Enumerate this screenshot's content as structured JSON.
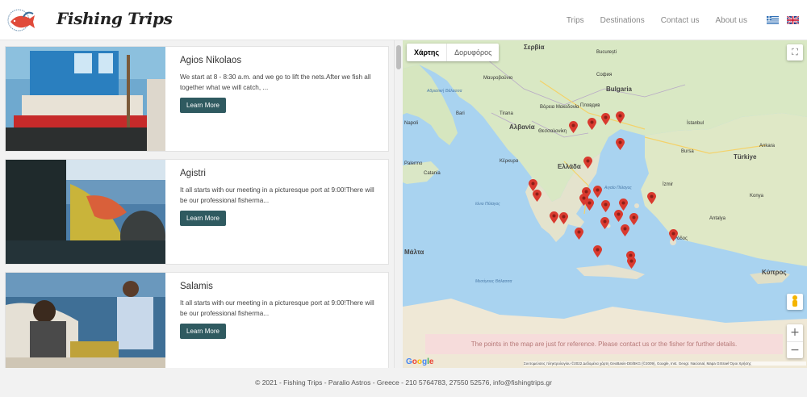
{
  "brand": {
    "name": "Fishing Trips"
  },
  "nav": {
    "items": [
      {
        "label": "Trips"
      },
      {
        "label": "Destinations"
      },
      {
        "label": "Contact us"
      },
      {
        "label": "About us"
      }
    ]
  },
  "trips": [
    {
      "title": "Agios Nikolaos",
      "description": "We start at 8 - 8:30 a.m. and we go to lift the nets.After we fish all together what we will catch, ...",
      "button": "Learn More"
    },
    {
      "title": "Agistri",
      "description": "It all starts with our meeting in a picturesque port at 9:00!There will be our professional fisherma...",
      "button": "Learn More"
    },
    {
      "title": "Salamis",
      "description": "It all starts with our meeting in a picturesque port at 9:00!There will be our professional fisherma...",
      "button": "Learn More"
    }
  ],
  "map": {
    "type_map": "Χάρτης",
    "type_satellite": "Δορυφόρος",
    "notice": "The points in the map are just for reference. Please contact us or the fisher for further details.",
    "google": "Google",
    "attribution": "Συντομεύσεις πληκτρολογίου   ©2022 Δεδομένα χάρτη GeoBasis-DE/BKG (©2009), Google, Inst. Geogr. Nacional, Mapa GISrael   Όροι Χρήσης",
    "labels": {
      "serbia": "Σερβία",
      "bulgaria": "Bulgaria",
      "albania": "Αλβανία",
      "greece": "Ελλάδα",
      "turkey": "Türkiye",
      "malta": "Μάλτα",
      "cyprus": "Κύπρος",
      "montenegro": "Μαυροβούνιο",
      "macedonia": "Βόρεια Μακεδονία",
      "sofia": "София",
      "istanbul": "İstanbul",
      "ankara": "Ankara",
      "izmir": "İzmir",
      "antalya": "Antalya",
      "konya": "Konya",
      "tirana": "Tirana",
      "thessaloniki": "Θεσσαλονίκη",
      "napoli": "Napoli",
      "palermo": "Palermo",
      "catania": "Catania",
      "bari": "Bari",
      "kerkyra": "Κέρκυρα",
      "rhodes": "Ρόδος",
      "aegean": "Αιγαίο Πέλαγος",
      "ionian": "Ιόνιο Πέλαγος",
      "mediterranean": "Μεσόγειος Θάλασσα",
      "adriatic": "Αδριατική Θάλασσα",
      "bucuresti": "București",
      "plovdiv": "Пловдив",
      "bursa": "Bursa"
    }
  },
  "footer": {
    "text": "© 2021 - Fishing Trips - Paralio Astros - Greece - 210 5764783, 27550 52576, info@fishingtrips.gr"
  },
  "colors": {
    "accent": "#2f5a60",
    "pin": "#d93a2f",
    "sea": "#a9d3f0",
    "land": "#eae6d8",
    "green": "#cde3b5"
  }
}
